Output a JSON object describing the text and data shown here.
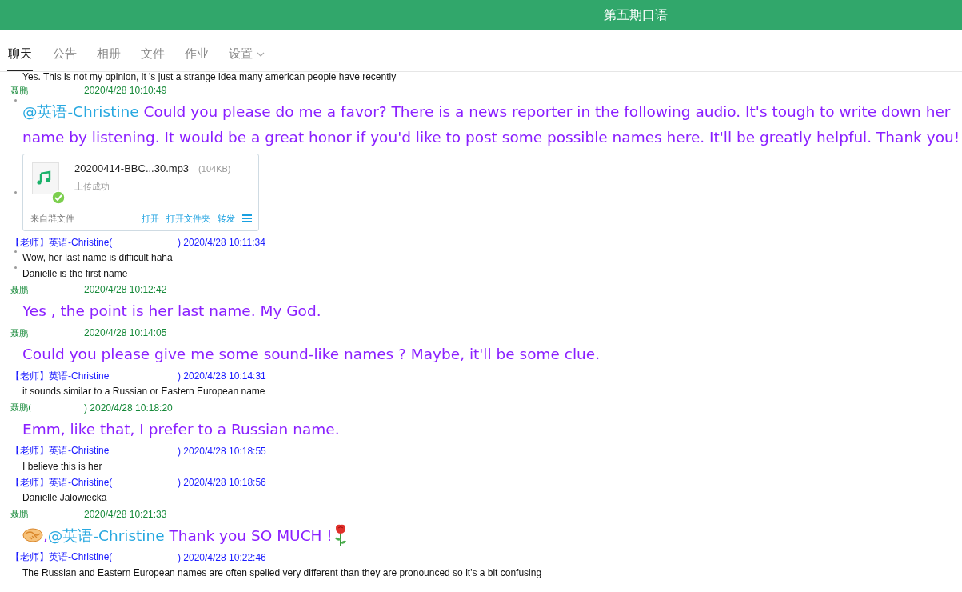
{
  "window": {
    "title": "第五期口语"
  },
  "tabs": [
    {
      "label": "聊天",
      "selected": true
    },
    {
      "label": "公告",
      "selected": false
    },
    {
      "label": "相册",
      "selected": false
    },
    {
      "label": "文件",
      "selected": false
    },
    {
      "label": "作业",
      "selected": false
    },
    {
      "label": "设置",
      "selected": false,
      "dropdown": true
    }
  ],
  "messages": [
    {
      "kind": "small",
      "bullet": false,
      "text": "Yes. This is not my opinion, it 's just a strange idea many american people have recently"
    },
    {
      "kind": "student-header",
      "sender": "聂鹏",
      "time": "2020/4/28 10:10:49"
    },
    {
      "kind": "big",
      "bullet": true,
      "parts": [
        {
          "kind": "mention",
          "text": "@英语-Christine"
        },
        {
          "kind": "text",
          "text": " Could you please do me a favor? There is a news reporter in the following audio. It's tough to write down her name by listening.  It would be a great honor if you'd like to post some possible names here. It'll be greatly helpful. Thank you!"
        }
      ]
    },
    {
      "kind": "file",
      "bullet": true,
      "name": "20200414-BBC...30.mp3",
      "size": "(104KB)",
      "status": "上传成功",
      "source": "来自群文件",
      "actions": [
        "打开",
        "打开文件夹",
        "转发"
      ]
    },
    {
      "kind": "teacher-header",
      "sender": "【老师】英语-Christine(",
      "time": ") 2020/4/28 10:11:34"
    },
    {
      "kind": "small",
      "bullet": true,
      "text": "Wow, her last name is difficult haha"
    },
    {
      "kind": "small",
      "bullet": true,
      "text": "Danielle is the first name"
    },
    {
      "kind": "student-header",
      "sender": "聂鹏",
      "time": "2020/4/28 10:12:42"
    },
    {
      "kind": "big",
      "bullet": false,
      "parts": [
        {
          "kind": "text",
          "text": "Yes , the point is her last name. My God."
        }
      ]
    },
    {
      "kind": "student-header",
      "sender": "聂鹏",
      "time": "2020/4/28 10:14:05"
    },
    {
      "kind": "big",
      "bullet": false,
      "parts": [
        {
          "kind": "text",
          "text": "Could you please give me some sound-like names ?  Maybe, it'll be some clue."
        }
      ]
    },
    {
      "kind": "teacher-header",
      "sender": "【老师】英语-Christine",
      "time": ") 2020/4/28 10:14:31"
    },
    {
      "kind": "small",
      "bullet": false,
      "text": "it sounds similar to a Russian or Eastern European name"
    },
    {
      "kind": "student-header",
      "sender": "聂鹏(",
      "time": ") 2020/4/28 10:18:20"
    },
    {
      "kind": "big",
      "bullet": false,
      "parts": [
        {
          "kind": "text",
          "text": "Emm, like that, I prefer to a Russian name."
        }
      ]
    },
    {
      "kind": "teacher-header",
      "sender": "【老师】英语-Christine",
      "time": ") 2020/4/28 10:18:55"
    },
    {
      "kind": "small",
      "bullet": false,
      "text": "I believe this is her"
    },
    {
      "kind": "teacher-header",
      "sender": "【老师】英语-Christine(",
      "time": ") 2020/4/28 10:18:56"
    },
    {
      "kind": "small",
      "bullet": false,
      "text": "Danielle Jalowiecka"
    },
    {
      "kind": "student-header",
      "sender": "聂鹏",
      "time": "2020/4/28 10:21:33"
    },
    {
      "kind": "big",
      "bullet": false,
      "parts": [
        {
          "kind": "handshake"
        },
        {
          "kind": "text",
          "text": ","
        },
        {
          "kind": "mention",
          "text": "@英语-Christine"
        },
        {
          "kind": "text",
          "text": " Thank you SO MUCH !"
        },
        {
          "kind": "rose"
        }
      ]
    },
    {
      "kind": "teacher-header",
      "sender": "【老师】英语-Christine(",
      "time": ") 2020/4/28 10:22:46"
    },
    {
      "kind": "small",
      "bullet": false,
      "text": "The Russian and Eastern European names are often spelled very different than they are pronounced so it's a bit confusing"
    }
  ]
}
